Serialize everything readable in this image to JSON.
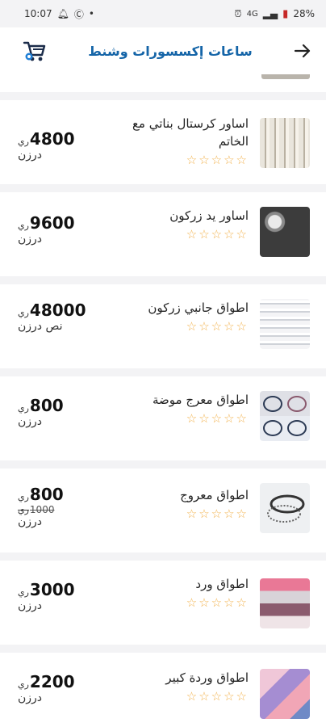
{
  "status_bar": {
    "time": "10:07",
    "network": "4G",
    "battery": "28%"
  },
  "header": {
    "title": "ساعات إكسسورات وشنط"
  },
  "products": [
    {
      "title": "اساور كرستال بناتي مع الخاتم",
      "price": "4800",
      "currency": "ري",
      "old_price": "",
      "unit": "درزن",
      "rating": 0
    },
    {
      "title": "اساور يد زركون",
      "price": "9600",
      "currency": "ري",
      "old_price": "",
      "unit": "درزن",
      "rating": 0
    },
    {
      "title": "اطواق جانبي زركون",
      "price": "48000",
      "currency": "ري",
      "old_price": "",
      "unit": "نص درزن",
      "rating": 0
    },
    {
      "title": "اطواق معرج موضة",
      "price": "800",
      "currency": "ري",
      "old_price": "",
      "unit": "درزن",
      "rating": 0
    },
    {
      "title": "اطواق معروج",
      "price": "800",
      "currency": "ري",
      "old_price": "1000",
      "unit": "درزن",
      "rating": 0
    },
    {
      "title": "اطواق ورد",
      "price": "3000",
      "currency": "ري",
      "old_price": "",
      "unit": "درزن",
      "rating": 0
    },
    {
      "title": "اطواق وردة كبير",
      "price": "2200",
      "currency": "ري",
      "old_price": "",
      "unit": "درزن",
      "rating": 0
    }
  ],
  "colors": {
    "accent": "#1565a8",
    "star": "#f2b24e",
    "battery_low": "#c62828"
  }
}
